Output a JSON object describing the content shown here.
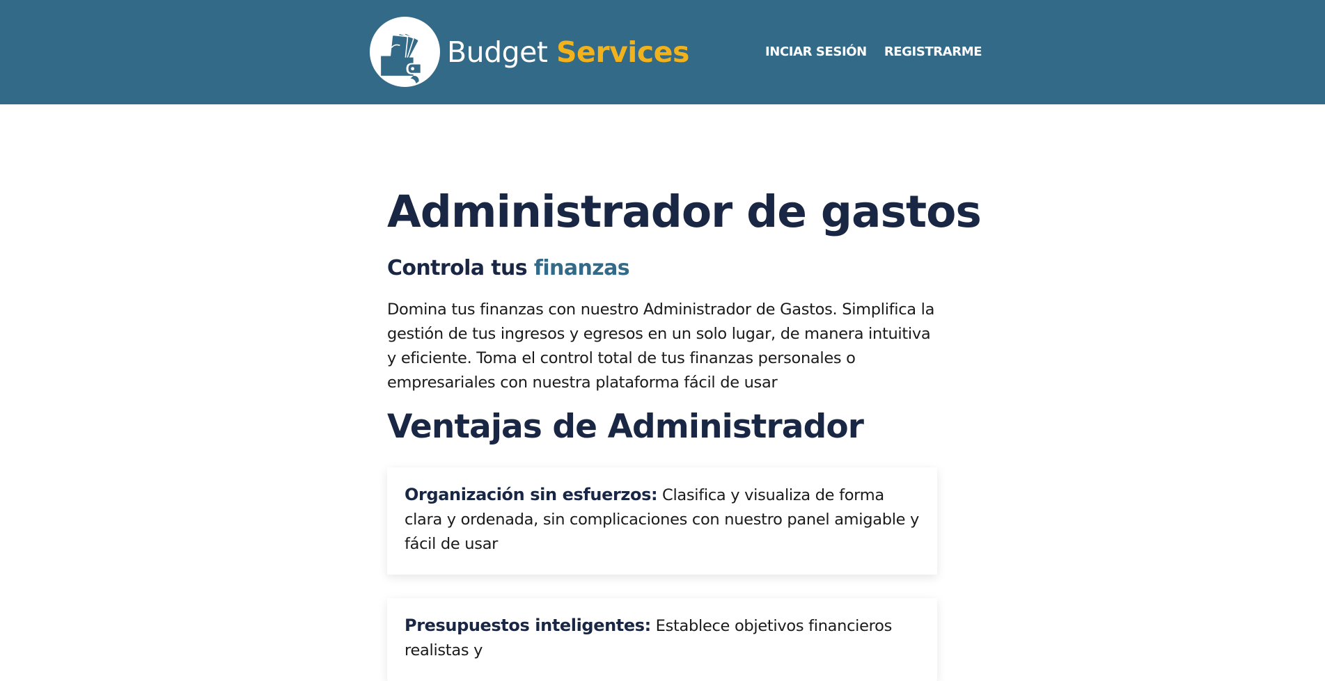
{
  "header": {
    "brand_primary": "Budget",
    "brand_accent": "Services",
    "nav": [
      {
        "label": "INCIAR SESIÓN"
      },
      {
        "label": "REGISTRARME"
      }
    ]
  },
  "colors": {
    "header_bg": "#336a88",
    "brand_accent": "#f2b21c",
    "heading": "#1a2744",
    "highlight": "#336a88"
  },
  "main": {
    "title": "Administrador de gastos",
    "subtitle_prefix": "Controla tus",
    "subtitle_highlight": "finanzas",
    "intro": "Domina tus finanzas con nuestro Administrador de Gastos. Simplifica la gestión de tus ingresos y egresos en un solo lugar, de manera intuitiva y eficiente. Toma el control total de tus finanzas personales o empresariales con nuestra plataforma fácil de usar",
    "section_title": "Ventajas de Administrador",
    "advantages": [
      {
        "title": "Organización sin esfuerzos:",
        "text": "Clasifica y visualiza de forma clara y ordenada, sin complicaciones con nuestro panel amigable y fácil de usar"
      },
      {
        "title": "Presupuestos inteligentes:",
        "text": "Establece objetivos financieros realistas y"
      }
    ]
  },
  "icons": {
    "logo": "wallet-logo-icon"
  }
}
